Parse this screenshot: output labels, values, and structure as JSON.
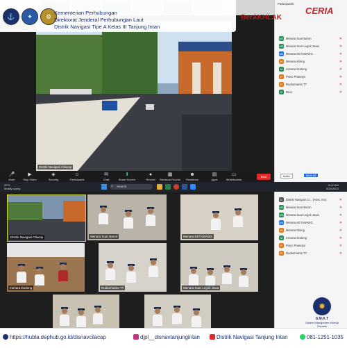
{
  "header": {
    "lines": [
      "Kementerian Perhubungan",
      "Direktorat Jenderal Perhubungan Laut",
      "Distrik Navigasi Tipe A Kelas III Tanjung Intan"
    ]
  },
  "brand": {
    "berakhlak": "BerAKHLAK",
    "ceria": "CERIA"
  },
  "zoom_top": {
    "main_video_label": "Distrik Navigasi Cilacap",
    "toolbar": [
      {
        "label": "Mute",
        "icon": "microphone-icon"
      },
      {
        "label": "Stop Video",
        "icon": "video-icon"
      },
      {
        "label": "Security",
        "icon": "shield-icon"
      },
      {
        "label": "Participants",
        "icon": "people-icon"
      },
      {
        "label": "Chat",
        "icon": "chat-icon"
      },
      {
        "label": "Share Screen",
        "icon": "share-icon"
      },
      {
        "label": "Record",
        "icon": "record-icon"
      },
      {
        "label": "Breakout Rooms",
        "icon": "grid-icon"
      },
      {
        "label": "Reactions",
        "icon": "smile-icon"
      },
      {
        "label": "Apps",
        "icon": "apps-icon"
      },
      {
        "label": "Whiteboards",
        "icon": "whiteboard-icon"
      }
    ],
    "end_label": "End"
  },
  "participants_top": {
    "title": "Participants",
    "rows": [
      {
        "initial": "MS",
        "name": "Menara Suar Baron",
        "color": "#2e8b57"
      },
      {
        "initial": "MS",
        "name": "Menara Suar Legok Jawa",
        "color": "#2e8b57"
      },
      {
        "initial": "MK",
        "name": "Menara KETAWANG",
        "color": "#1e6fd9"
      },
      {
        "initial": "M",
        "name": "Menara Kliring",
        "color": "#e07b20"
      },
      {
        "initial": "M",
        "name": "menara Dodong",
        "color": "#2e8b57"
      },
      {
        "initial": "P",
        "name": "Pinco Prasetyo",
        "color": "#e07b20"
      },
      {
        "initial": "R",
        "name": "Rudiarmanto TT",
        "color": "#e07b20"
      },
      {
        "initial": "B",
        "name": "Bruo",
        "color": "#2e8b57"
      }
    ],
    "invite_label": "Invite",
    "mute_all_label": "Mute All"
  },
  "taskbar": {
    "weather_temp": "29°C",
    "weather_desc": "Mostly sunny",
    "search_placeholder": "Search",
    "time": "8:02 AM",
    "date": "5/29/2023"
  },
  "gallery": {
    "tiles": [
      {
        "label": "Distrik Navigasi Cilacap"
      },
      {
        "label": "Menara Suar Baron"
      },
      {
        "label": "Menara KETAWANG"
      },
      {
        "label": "menara Dodong"
      },
      {
        "label": "Rudiarmanto TT"
      },
      {
        "label": "Menara Suar Legok Jawa"
      }
    ]
  },
  "participants_bottom": {
    "rows": [
      {
        "initial": "D",
        "name": "Distrik Navigasi Ci... (Host, me)",
        "color": "#555555"
      },
      {
        "initial": "MS",
        "name": "Menara Suar Baron",
        "color": "#2e8b57"
      },
      {
        "initial": "MS",
        "name": "Menara Suar Legok Jawa",
        "color": "#2e8b57"
      },
      {
        "initial": "MK",
        "name": "Menara KETAWANG",
        "color": "#1e6fd9"
      },
      {
        "initial": "M",
        "name": "Menara Kliring",
        "color": "#e07b20"
      },
      {
        "initial": "M",
        "name": "menara Dodong",
        "color": "#2e8b57"
      },
      {
        "initial": "P",
        "name": "Pinco Prasetyo",
        "color": "#e07b20"
      },
      {
        "initial": "R",
        "name": "Rudiarmanto TT",
        "color": "#e07b20"
      }
    ]
  },
  "smkt": {
    "title": "S.M.K.T",
    "subtitle": "Sistem Manajemen Kinerja Terpadu"
  },
  "footer": {
    "website": "https://hubla.dephub.go.id/disnavcilacap",
    "instagram": "djpl__disnavtanjungintan",
    "youtube": "Distrik Navigasi Tanjung Intan",
    "phone": "081-1251-1035"
  }
}
